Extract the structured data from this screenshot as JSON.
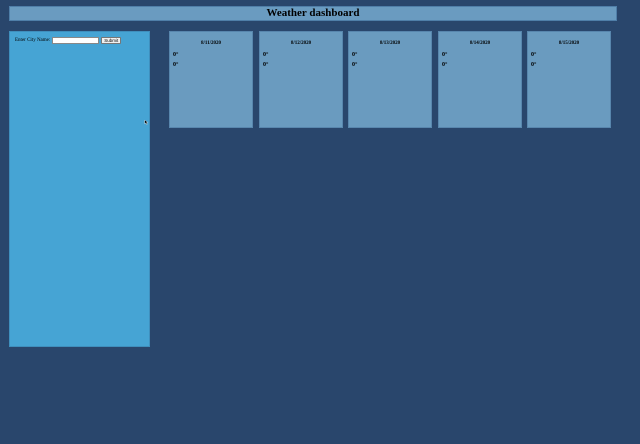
{
  "header": {
    "title": "Weather dashboard"
  },
  "search": {
    "label": "Enter City Name:",
    "value": "",
    "placeholder": "",
    "submit_label": "Submit"
  },
  "forecast": [
    {
      "date": "8/11/2020",
      "line1": "0°",
      "line2": "0°"
    },
    {
      "date": "8/12/2020",
      "line1": "0°",
      "line2": "0°"
    },
    {
      "date": "8/13/2020",
      "line1": "0°",
      "line2": "0°"
    },
    {
      "date": "8/14/2020",
      "line1": "0°",
      "line2": "0°"
    },
    {
      "date": "8/15/2020",
      "line1": "0°",
      "line2": "0°"
    }
  ],
  "colors": {
    "background": "#29466c",
    "header": "#6a9bc0",
    "sidebar": "#46a4d4",
    "card": "#6a9bbf"
  },
  "icons": {
    "cursor": "mouse-pointer-icon"
  }
}
